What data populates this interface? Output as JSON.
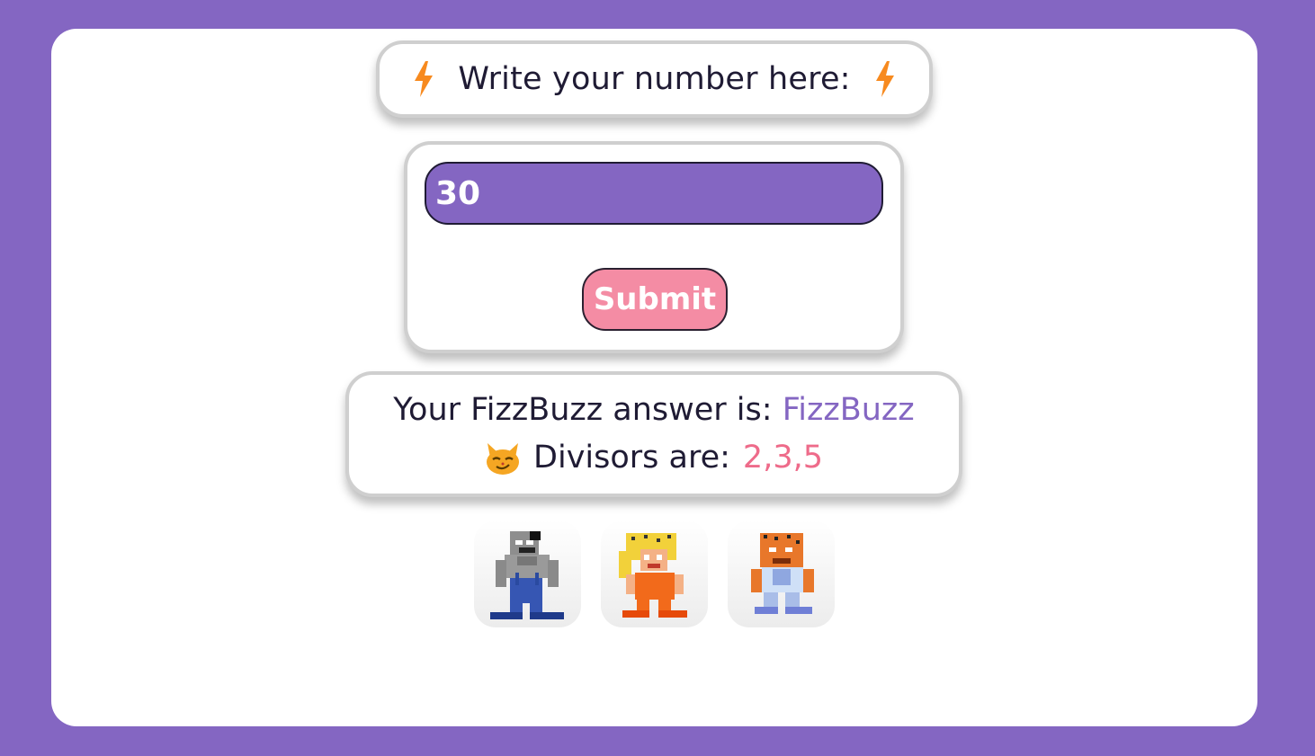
{
  "header": {
    "title": "Write your number here:",
    "left_icon": "lightning-bolt-icon",
    "right_icon": "lightning-bolt-icon",
    "icon_color": "#f78a1f"
  },
  "form": {
    "number_value": "30",
    "submit_label": "Submit"
  },
  "result": {
    "answer_label": "Your FizzBuzz answer is:",
    "answer_value": "FizzBuzz",
    "divisors_icon": "smirking-cat-icon",
    "divisors_label": "Divisors are:",
    "divisors_value": "2,3,5"
  },
  "avatars": [
    {
      "name": "gray-wolf-pixel-character"
    },
    {
      "name": "blonde-orange-pixel-character"
    },
    {
      "name": "orange-tiger-pixel-character"
    }
  ],
  "colors": {
    "background": "#8466c2",
    "card": "#ffffff",
    "accent_purple": "#8466c2",
    "accent_pink": "#f48ca4",
    "divisors_pink": "#ee6b8a",
    "text_dark": "#1f1b34"
  }
}
